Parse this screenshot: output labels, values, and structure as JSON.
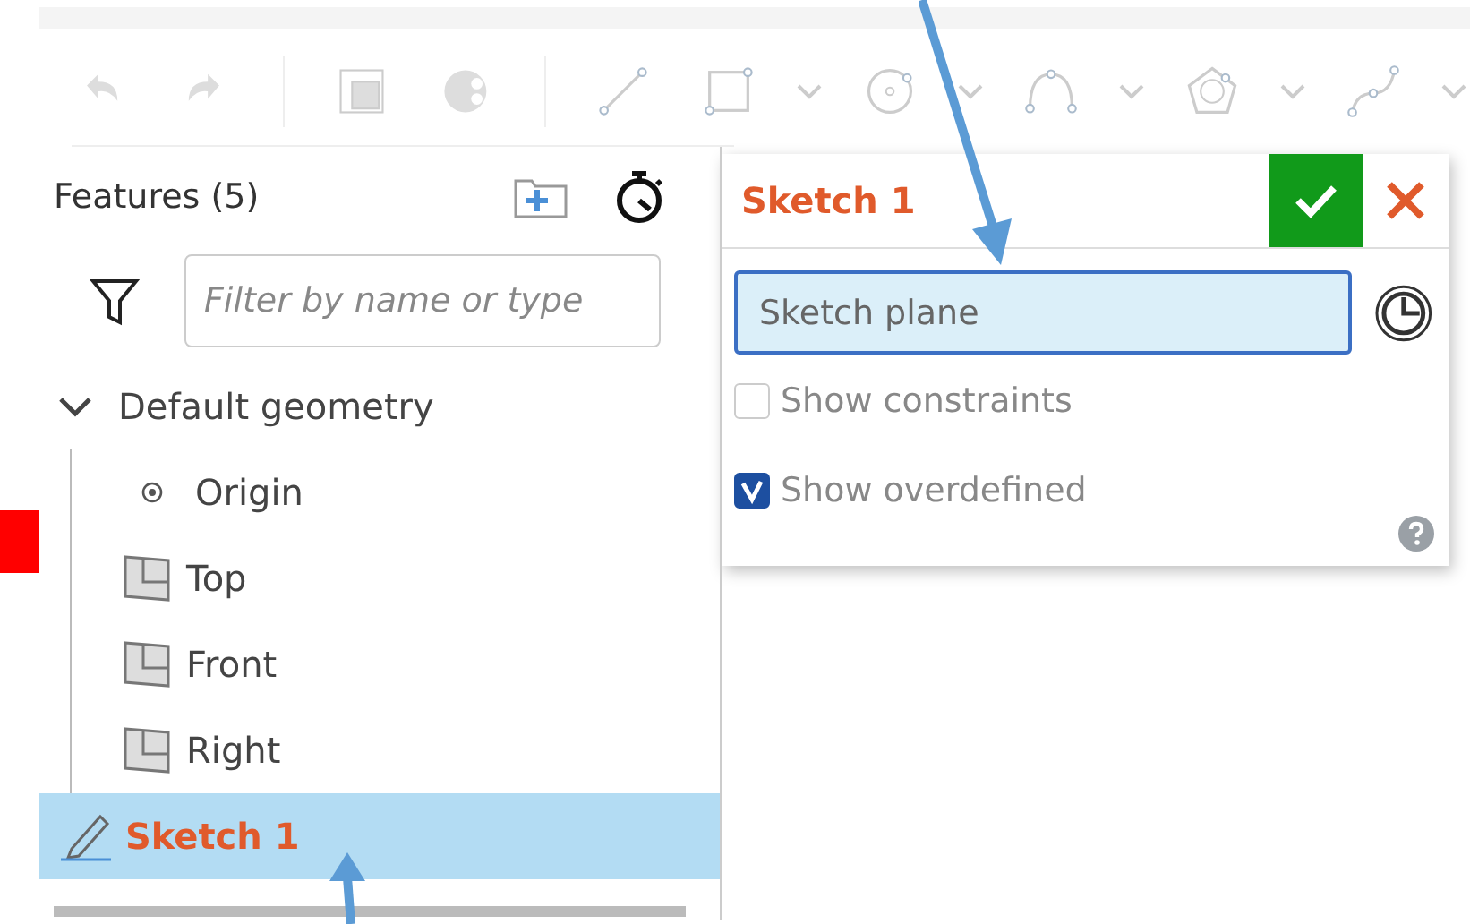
{
  "features_panel": {
    "title": "Features (5)",
    "filter": {
      "placeholder": "Filter by name or type"
    },
    "tree": [
      {
        "label": "Default geometry",
        "kind": "group",
        "expanded": true,
        "selected": false,
        "children": [
          {
            "label": "Origin",
            "kind": "point",
            "selected": false
          },
          {
            "label": "Top",
            "kind": "plane",
            "selected": false
          },
          {
            "label": "Front",
            "kind": "plane",
            "selected": false
          },
          {
            "label": "Right",
            "kind": "plane",
            "selected": false
          }
        ]
      },
      {
        "label": "Sketch 1",
        "kind": "sketch",
        "selected": true
      }
    ]
  },
  "sketch_dialog": {
    "title": "Sketch 1",
    "plane_field": {
      "placeholder": "Sketch plane"
    },
    "options": [
      {
        "label": "Show constraints",
        "checked": false
      },
      {
        "label": "Show overdefined",
        "checked": true
      }
    ]
  }
}
